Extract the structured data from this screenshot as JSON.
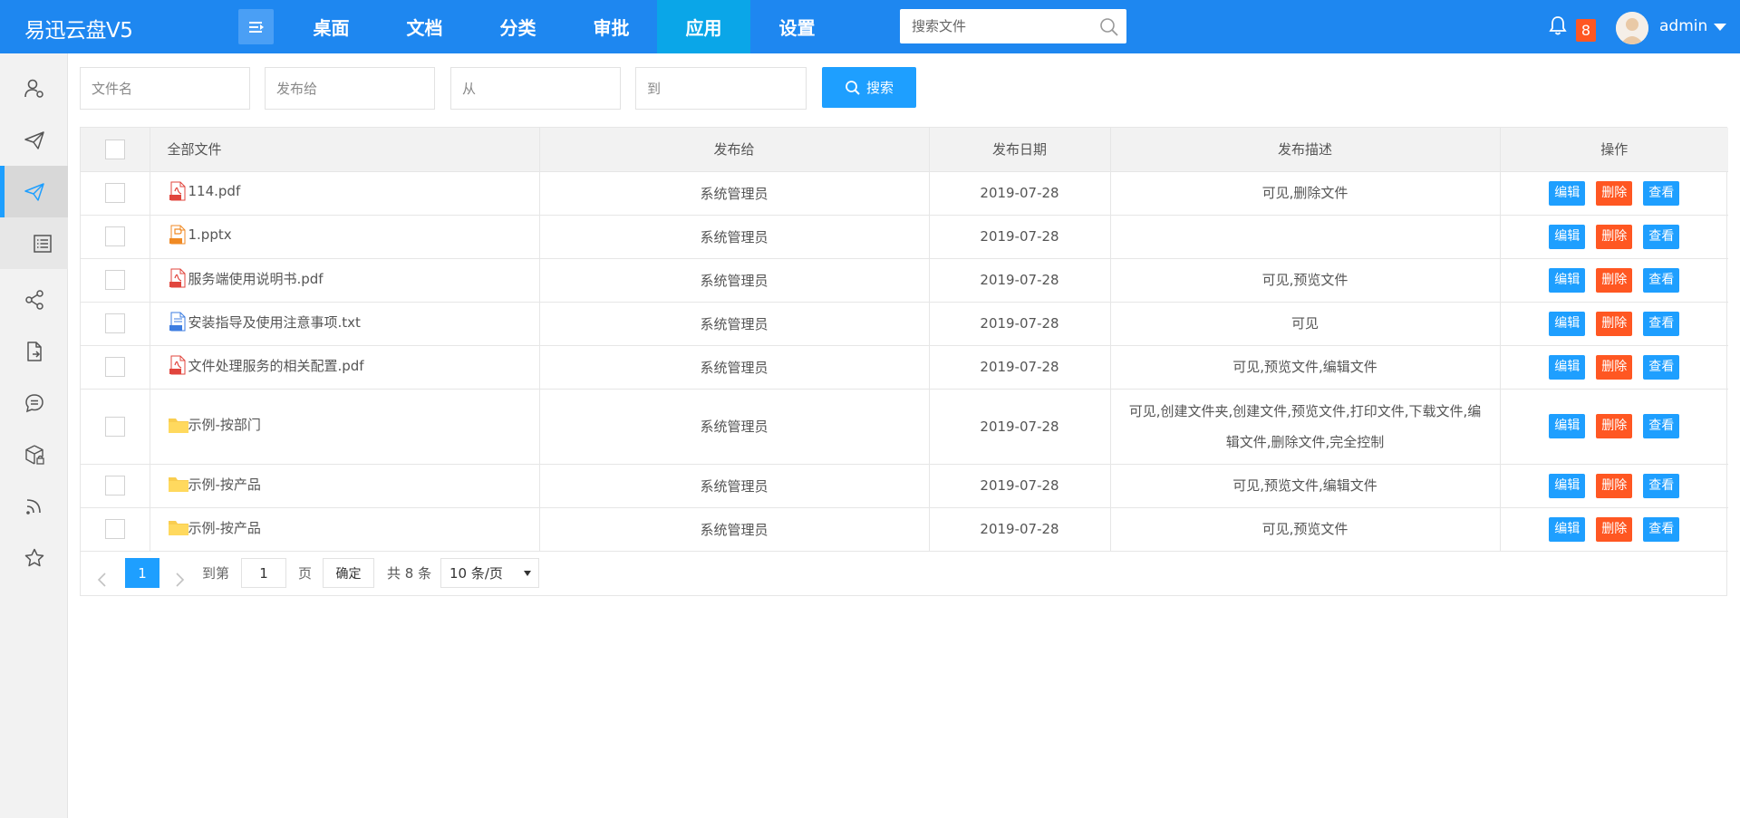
{
  "app": {
    "title": "易迅云盘V5"
  },
  "nav": {
    "items": [
      {
        "label": "桌面"
      },
      {
        "label": "文档"
      },
      {
        "label": "分类"
      },
      {
        "label": "审批"
      },
      {
        "label": "应用",
        "active": true
      },
      {
        "label": "设置"
      }
    ]
  },
  "search": {
    "placeholder": "搜索文件"
  },
  "notifications": {
    "count": "8"
  },
  "user": {
    "name": "admin"
  },
  "sidebar": {
    "icons": [
      "user-settings-icon",
      "send-icon",
      "send-icon",
      "list-icon",
      "share-icon",
      "file-export-icon",
      "chat-icon",
      "package-lock-icon",
      "rss-icon",
      "star-icon"
    ]
  },
  "filters": {
    "filename_placeholder": "文件名",
    "publish_to_placeholder": "发布给",
    "from_placeholder": "从",
    "to_placeholder": "到",
    "search_label": "搜索"
  },
  "table": {
    "headers": {
      "name": "全部文件",
      "publish_to": "发布给",
      "date": "发布日期",
      "desc": "发布描述",
      "ops": "操作"
    },
    "actions": {
      "edit": "编辑",
      "delete": "删除",
      "view": "查看"
    },
    "rows": [
      {
        "type": "pdf",
        "name": "114.pdf",
        "publish_to": "系统管理员",
        "date": "2019-07-28",
        "desc": "可见,删除文件"
      },
      {
        "type": "pptx",
        "name": "1.pptx",
        "publish_to": "系统管理员",
        "date": "2019-07-28",
        "desc": ""
      },
      {
        "type": "pdf",
        "name": "服务端使用说明书.pdf",
        "publish_to": "系统管理员",
        "date": "2019-07-28",
        "desc": "可见,预览文件"
      },
      {
        "type": "txt",
        "name": "安装指导及使用注意事项.txt",
        "publish_to": "系统管理员",
        "date": "2019-07-28",
        "desc": "可见"
      },
      {
        "type": "pdf",
        "name": "文件处理服务的相关配置.pdf",
        "publish_to": "系统管理员",
        "date": "2019-07-28",
        "desc": "可见,预览文件,编辑文件"
      },
      {
        "type": "folder",
        "name": "示例-按部门",
        "publish_to": "系统管理员",
        "date": "2019-07-28",
        "desc": "可见,创建文件夹,创建文件,预览文件,打印文件,下载文件,编辑文件,删除文件,完全控制"
      },
      {
        "type": "folder",
        "name": "示例-按产品",
        "publish_to": "系统管理员",
        "date": "2019-07-28",
        "desc": "可见,预览文件,编辑文件"
      },
      {
        "type": "folder",
        "name": "示例-按产品",
        "publish_to": "系统管理员",
        "date": "2019-07-28",
        "desc": "可见,预览文件"
      }
    ]
  },
  "pager": {
    "current": "1",
    "goto_label": "到第",
    "page_value": "1",
    "page_label": "页",
    "confirm": "确定",
    "total": "共 8 条",
    "page_size": "10 条/页"
  },
  "colors": {
    "topbar": "#1e87f0",
    "nav_active": "#0aa6e8",
    "primary": "#1e9fff",
    "danger": "#ff5722"
  }
}
